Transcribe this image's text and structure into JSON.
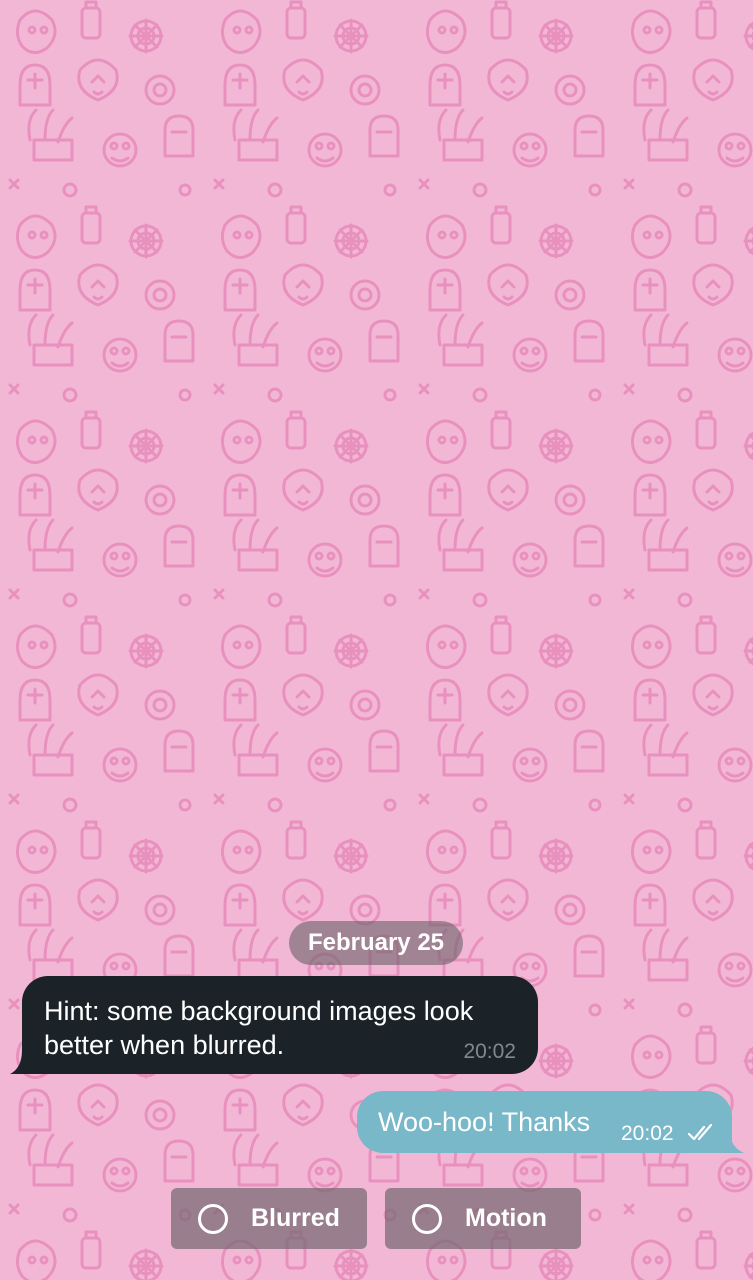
{
  "chat": {
    "date_label": "February 25",
    "incoming": {
      "text": "Hint: some background images look better when blurred.",
      "time": "20:02"
    },
    "outgoing": {
      "text": "Woo-hoo! Thanks",
      "time": "20:02",
      "status_icon": "double-check-icon"
    }
  },
  "options": {
    "blurred_label": "Blurred",
    "motion_label": "Motion",
    "blurred_icon": "radio-circle-icon",
    "motion_icon": "radio-circle-icon"
  },
  "colors": {
    "background": "#f3b7d6",
    "pattern": "#e98fbd",
    "incoming_bubble": "#1b2328",
    "outgoing_bubble": "#79b8c8"
  }
}
